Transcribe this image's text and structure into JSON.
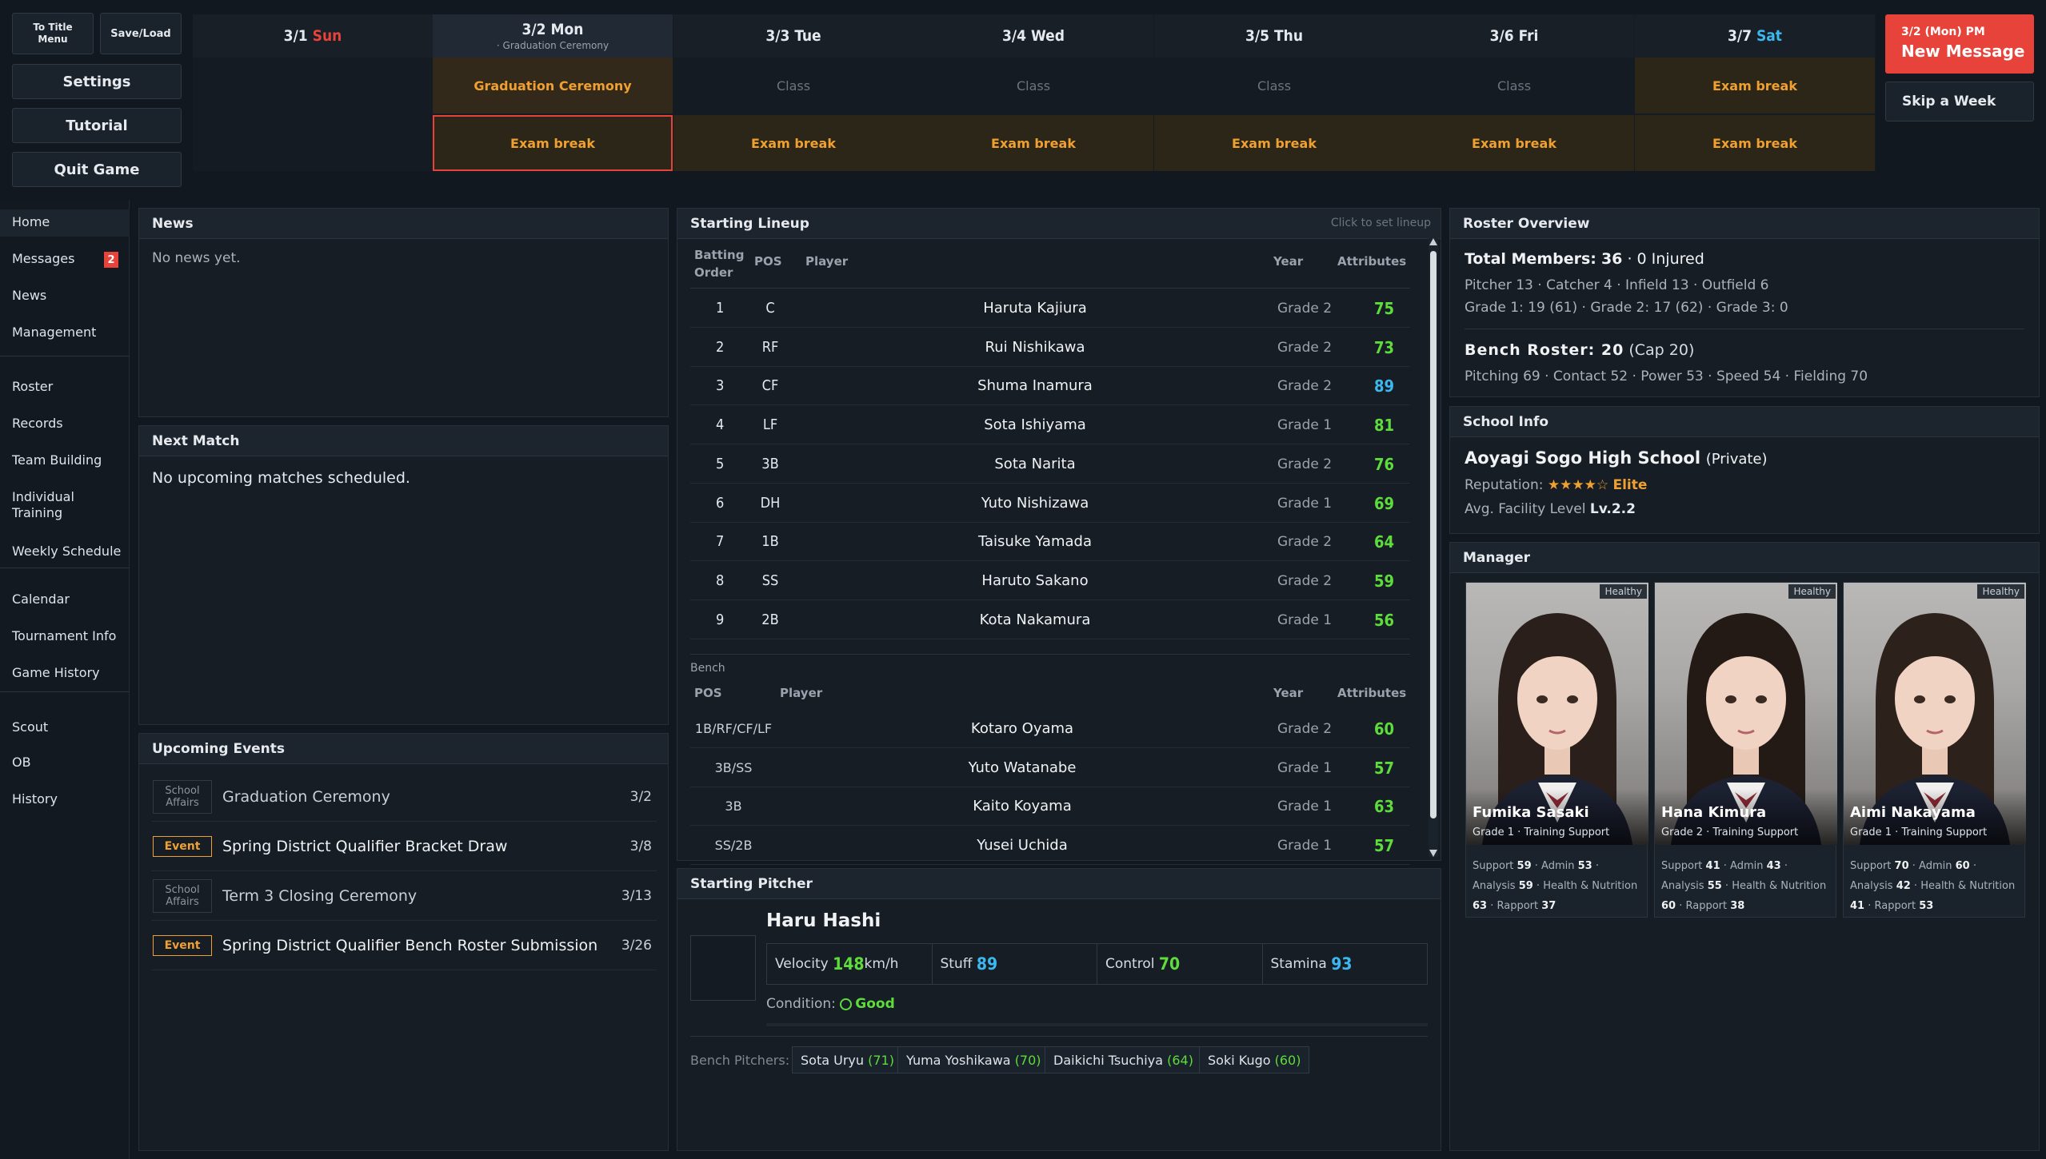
{
  "top_buttons": {
    "to_title": "To Title Menu",
    "save_load": "Save/Load",
    "settings": "Settings",
    "tutorial": "Tutorial",
    "quit": "Quit Game"
  },
  "calendar": [
    {
      "date": "3/1",
      "dow": "Sun",
      "sub": "",
      "row1": "",
      "row2": ""
    },
    {
      "date": "3/2",
      "dow": "Mon",
      "sub": "· Graduation Ceremony",
      "row1": "Graduation Ceremony",
      "row2": "Exam break"
    },
    {
      "date": "3/3",
      "dow": "Tue",
      "sub": "",
      "row1": "Class",
      "row2": "Exam break"
    },
    {
      "date": "3/4",
      "dow": "Wed",
      "sub": "",
      "row1": "Class",
      "row2": "Exam break"
    },
    {
      "date": "3/5",
      "dow": "Thu",
      "sub": "",
      "row1": "Class",
      "row2": "Exam break"
    },
    {
      "date": "3/6",
      "dow": "Fri",
      "sub": "",
      "row1": "Class",
      "row2": "Exam break"
    },
    {
      "date": "3/7",
      "dow": "Sat",
      "sub": "",
      "row1": "Exam break",
      "row2": "Exam break"
    }
  ],
  "message": {
    "time": "3/2 (Mon) PM",
    "title": "New Message",
    "skip": "Skip a Week"
  },
  "sidebar": {
    "items": [
      "Home",
      "Messages",
      "News",
      "Management",
      "Roster",
      "Records",
      "Team Building",
      "Individual Training",
      "Weekly Schedule",
      "Calendar",
      "Tournament Info",
      "Game History",
      "Scout",
      "OB",
      "History"
    ],
    "messages_badge": "2"
  },
  "news": {
    "title": "News",
    "text": "No news yet."
  },
  "next_match": {
    "title": "Next Match",
    "text": "No upcoming matches scheduled."
  },
  "events": {
    "title": "Upcoming Events",
    "items": [
      {
        "tag": "School Affairs",
        "name": "Graduation Ceremony",
        "date": "3/2"
      },
      {
        "tag": "Event",
        "name": "Spring District Qualifier Bracket Draw",
        "date": "3/8"
      },
      {
        "tag": "School Affairs",
        "name": "Term 3 Closing Ceremony",
        "date": "3/13"
      },
      {
        "tag": "Event",
        "name": "Spring District Qualifier Bench Roster Submission",
        "date": "3/26"
      }
    ]
  },
  "lineup": {
    "title": "Starting Lineup",
    "hint": "Click to set lineup",
    "h_order": "Batting Order",
    "h_pos": "POS",
    "h_player": "Player",
    "h_year": "Year",
    "h_attr": "Attributes",
    "rows": [
      {
        "order": "1",
        "pos": "C",
        "name": "Haruta Kajiura",
        "year": "Grade 2",
        "attr": "75",
        "color": "g"
      },
      {
        "order": "2",
        "pos": "RF",
        "name": "Rui Nishikawa",
        "year": "Grade 2",
        "attr": "73",
        "color": "g"
      },
      {
        "order": "3",
        "pos": "CF",
        "name": "Shuma Inamura",
        "year": "Grade 2",
        "attr": "89",
        "color": "b"
      },
      {
        "order": "4",
        "pos": "LF",
        "name": "Sota Ishiyama",
        "year": "Grade 1",
        "attr": "81",
        "color": "g"
      },
      {
        "order": "5",
        "pos": "3B",
        "name": "Sota Narita",
        "year": "Grade 2",
        "attr": "76",
        "color": "g"
      },
      {
        "order": "6",
        "pos": "DH",
        "name": "Yuto Nishizawa",
        "year": "Grade 1",
        "attr": "69",
        "color": "g"
      },
      {
        "order": "7",
        "pos": "1B",
        "name": "Taisuke Yamada",
        "year": "Grade 2",
        "attr": "64",
        "color": "g"
      },
      {
        "order": "8",
        "pos": "SS",
        "name": "Haruto Sakano",
        "year": "Grade 2",
        "attr": "59",
        "color": "g"
      },
      {
        "order": "9",
        "pos": "2B",
        "name": "Kota Nakamura",
        "year": "Grade 1",
        "attr": "56",
        "color": "g"
      }
    ],
    "bench_label": "Bench",
    "bench": [
      {
        "pos": "1B/RF/CF/LF",
        "name": "Kotaro Oyama",
        "year": "Grade 2",
        "attr": "60"
      },
      {
        "pos": "3B/SS",
        "name": "Yuto Watanabe",
        "year": "Grade 1",
        "attr": "57"
      },
      {
        "pos": "3B",
        "name": "Kaito Koyama",
        "year": "Grade 1",
        "attr": "63"
      },
      {
        "pos": "SS/2B",
        "name": "Yusei Uchida",
        "year": "Grade 1",
        "attr": "57"
      }
    ]
  },
  "pitcher": {
    "title": "Starting Pitcher",
    "name": "Haru Hashi",
    "velocity_label": "Velocity",
    "velocity": "148",
    "velocity_unit": "km/h",
    "stuff_label": "Stuff",
    "stuff": "89",
    "control_label": "Control",
    "control": "70",
    "stamina_label": "Stamina",
    "stamina": "93",
    "condition_label": "Condition:",
    "condition": "Good",
    "bench_label": "Bench Pitchers:",
    "bench": [
      {
        "name": "Sota Uryu",
        "val": "(71)"
      },
      {
        "name": "Yuma Yoshikawa",
        "val": "(70)"
      },
      {
        "name": "Daikichi Tsuchiya",
        "val": "(64)"
      },
      {
        "name": "Soki Kugo",
        "val": "(60)"
      }
    ]
  },
  "roster": {
    "title": "Roster Overview",
    "total_label": "Total Members:",
    "total": "36",
    "injured": "· 0 Injured",
    "line2": "Pitcher 13 · Catcher 4 · Infield 13 · Outfield 6",
    "line3": "Grade 1: 19 (61) · Grade 2: 17 (62) · Grade 3: 0",
    "bench_title": "Bench Roster: 20",
    "bench_cap": "(Cap 20)",
    "bench_stats": "Pitching 69 · Contact 52 · Power 53 · Speed 54 · Fielding 70"
  },
  "school": {
    "title": "School Info",
    "name": "Aoyagi Sogo High School",
    "type": "(Private)",
    "rep_label": "Reputation:",
    "stars": "★★★★☆",
    "rep": "Elite",
    "facility_label": "Avg. Facility Level",
    "facility": "Lv.2.2"
  },
  "manager": {
    "title": "Manager",
    "cards": [
      {
        "status": "Healthy",
        "name": "Fumika Sasaki",
        "role": "Grade 1 · Training Support",
        "support": "59",
        "admin": "53",
        "analysis": "59",
        "health": "63",
        "rapport": "37"
      },
      {
        "status": "Healthy",
        "name": "Hana Kimura",
        "role": "Grade 2 · Training Support",
        "support": "41",
        "admin": "43",
        "analysis": "55",
        "health": "60",
        "rapport": "38"
      },
      {
        "status": "Healthy",
        "name": "Aimi Nakayama",
        "role": "Grade 1 · Training Support",
        "support": "70",
        "admin": "60",
        "analysis": "42",
        "health": "41",
        "rapport": "53"
      }
    ],
    "l_support": "Support",
    "l_admin": "Admin",
    "l_analysis": "Analysis",
    "l_health": "Health & Nutrition",
    "l_rapport": "Rapport"
  },
  "colors": {
    "accent": "#e8433a",
    "orange": "#f0a030",
    "green": "#5ddc3c",
    "blue": "#3db8ef"
  }
}
